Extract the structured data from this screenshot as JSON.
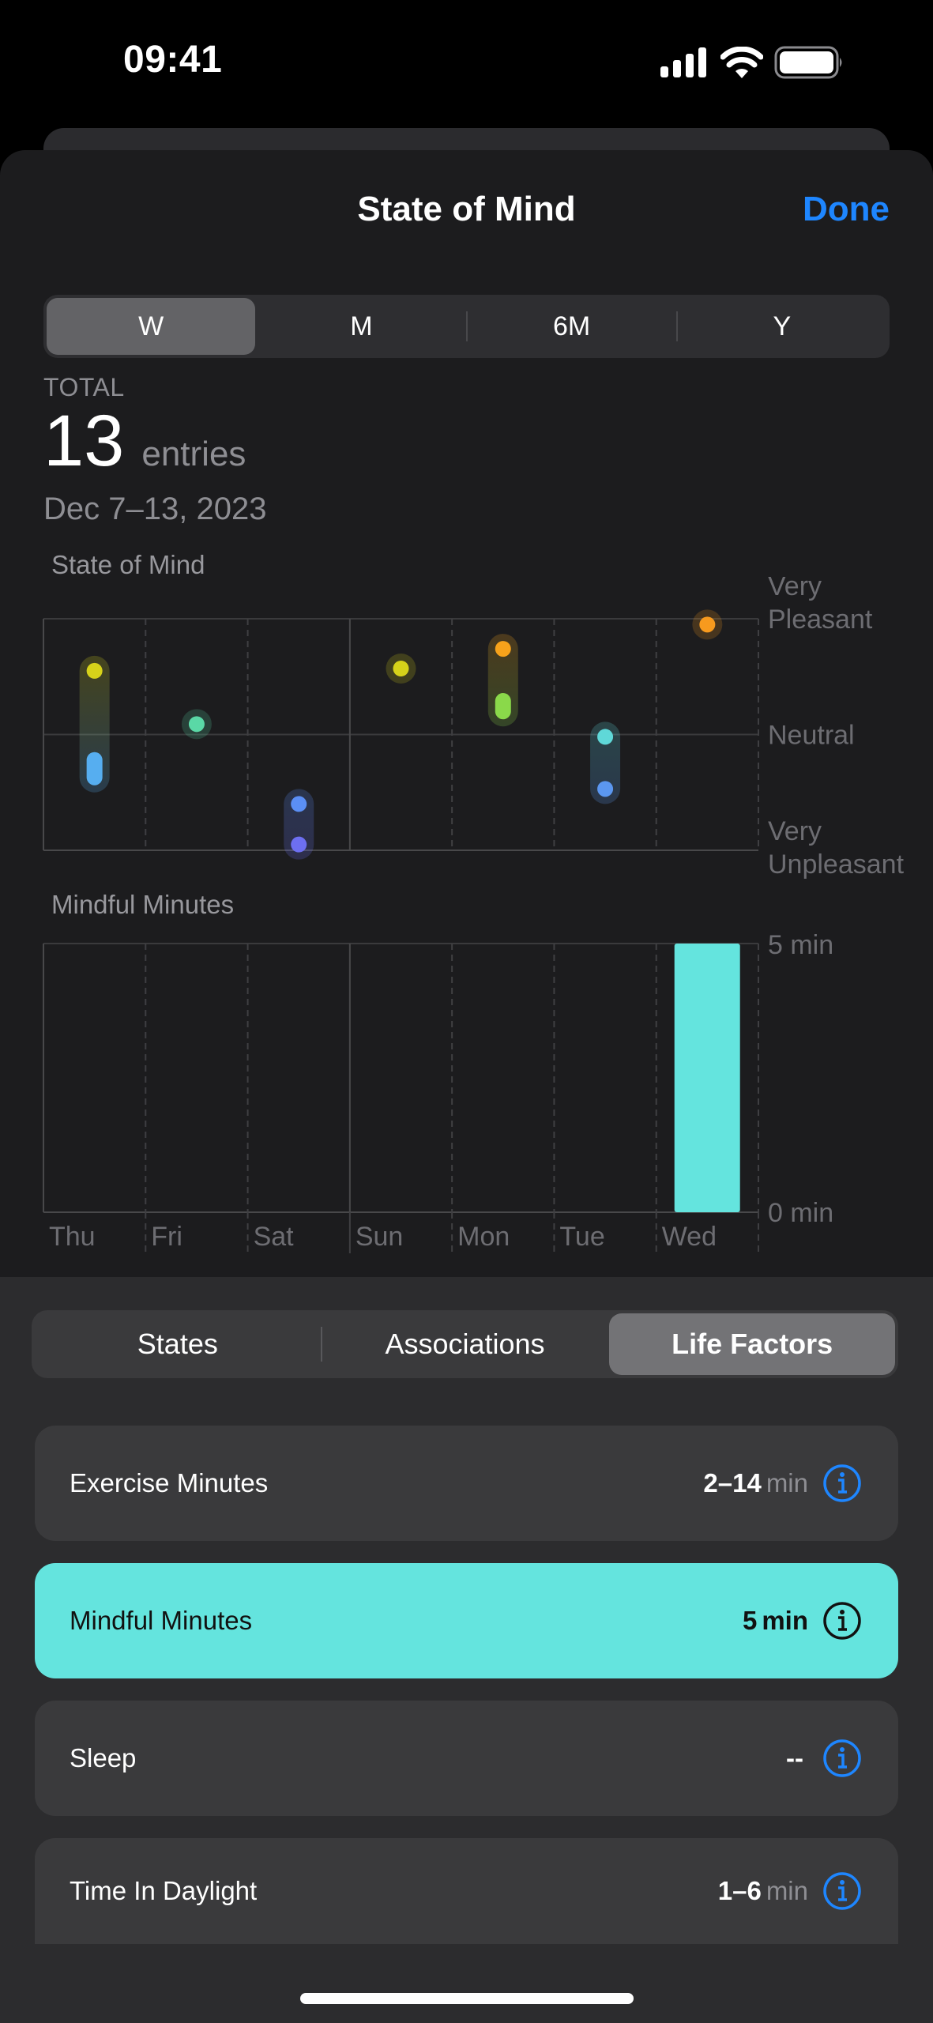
{
  "status_bar": {
    "time": "09:41",
    "icons": [
      "cellular-signal-icon",
      "wifi-icon",
      "battery-icon"
    ]
  },
  "nav": {
    "title": "State of Mind",
    "done_label": "Done"
  },
  "range_tabs": {
    "items": [
      "W",
      "M",
      "6M",
      "Y"
    ],
    "selected": "W"
  },
  "summary": {
    "label": "TOTAL",
    "value": "13",
    "unit": "entries",
    "date_range": "Dec 7–13, 2023"
  },
  "colors": {
    "accent": "#1e86ff",
    "mindful": "#64e4de"
  },
  "chart_data": [
    {
      "type": "scatter",
      "title": "State of Mind",
      "categories": [
        "Thu",
        "Fri",
        "Sat",
        "Sun",
        "Mon",
        "Tue",
        "Wed"
      ],
      "y_labels": {
        "top": [
          "Very",
          "Pleasant"
        ],
        "middle": [
          "Neutral"
        ],
        "bottom": [
          "Very",
          "Unpleasant"
        ]
      },
      "ylim": [
        -1,
        1
      ],
      "grid": true,
      "series": [
        {
          "day": "Thu",
          "points": [
            {
              "valence": 0.55,
              "color": "#d6d21a"
            },
            {
              "valence": -0.22,
              "valence_end": -0.37,
              "color": "#56aef0"
            }
          ],
          "range_colors": [
            "#d6d21a",
            "#56aef0"
          ]
        },
        {
          "day": "Fri",
          "points": [
            {
              "valence": 0.09,
              "color": "#5ad8a6"
            }
          ]
        },
        {
          "day": "Sat",
          "points": [
            {
              "valence": -0.6,
              "color": "#5b8ff5"
            },
            {
              "valence": -0.95,
              "color": "#6d6ff0"
            }
          ],
          "range_colors": [
            "#5b8ff5",
            "#6d6ff0"
          ]
        },
        {
          "day": "Sun",
          "points": [
            {
              "valence": 0.57,
              "color": "#d6d21a"
            }
          ]
        },
        {
          "day": "Mon",
          "points": [
            {
              "valence": 0.74,
              "color": "#f7a21b"
            },
            {
              "valence": 0.29,
              "valence_end": 0.2,
              "color": "#8ad94a"
            }
          ],
          "range_colors": [
            "#f7a21b",
            "#8ad94a"
          ]
        },
        {
          "day": "Tue",
          "points": [
            {
              "valence": -0.02,
              "color": "#5fd8d8"
            },
            {
              "valence": -0.47,
              "color": "#5b97f0"
            }
          ],
          "range_colors": [
            "#5fd8d8",
            "#5b97f0"
          ]
        },
        {
          "day": "Wed",
          "points": [
            {
              "valence": 0.95,
              "color": "#f79a1e"
            }
          ]
        }
      ]
    },
    {
      "type": "bar",
      "title": "Mindful Minutes",
      "categories": [
        "Thu",
        "Fri",
        "Sat",
        "Sun",
        "Mon",
        "Tue",
        "Wed"
      ],
      "values": [
        0,
        0,
        0,
        0,
        0,
        0,
        5
      ],
      "y_tick_labels": [
        "5 min",
        "0 min"
      ],
      "ylim": [
        0,
        5
      ],
      "color": "#64e4de",
      "grid": true
    }
  ],
  "detail_tabs": {
    "items": [
      "States",
      "Associations",
      "Life Factors"
    ],
    "selected": "Life Factors"
  },
  "life_factors": [
    {
      "name": "Exercise Minutes",
      "value": "2–14",
      "unit": "min",
      "highlighted": false
    },
    {
      "name": "Mindful Minutes",
      "value": "5",
      "unit": "min",
      "highlighted": true
    },
    {
      "name": "Sleep",
      "value": "--",
      "unit": "",
      "highlighted": false
    },
    {
      "name": "Time In Daylight",
      "value": "1–6",
      "unit": "min",
      "highlighted": false
    }
  ]
}
